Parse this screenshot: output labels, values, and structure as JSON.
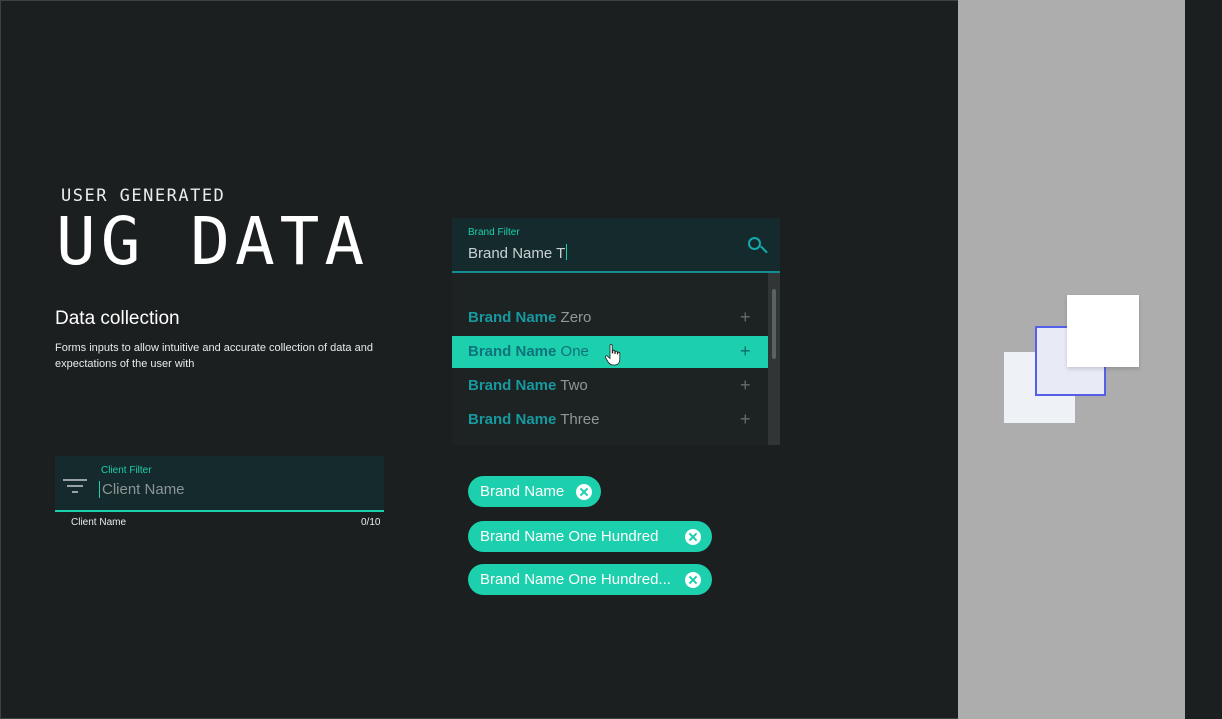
{
  "intro": {
    "eyebrow": "USER GENERATED",
    "title": "UG DATA",
    "section_title": "Data collection",
    "section_desc": "Forms inputs to allow intuitive and accurate collection of data and expectations of the user with"
  },
  "client_filter": {
    "label": "Client Filter",
    "placeholder": "Client Name",
    "helper_text": "Client Name",
    "counter": "0/10",
    "icon": "filter-icon"
  },
  "brand_filter": {
    "label": "Brand Filter",
    "value": "Brand Name T",
    "icon": "search-icon",
    "options": [
      {
        "match": "Brand Name",
        "rest": " Zero",
        "highlighted": false
      },
      {
        "match": "Brand Name",
        "rest": " One",
        "highlighted": true
      },
      {
        "match": "Brand Name",
        "rest": " Two",
        "highlighted": false
      },
      {
        "match": "Brand Name",
        "rest": " Three",
        "highlighted": false
      }
    ],
    "add_symbol": "+"
  },
  "chips": [
    {
      "label": "Brand Name"
    },
    {
      "label": "Brand Name One Hundred"
    },
    {
      "label": "Brand Name One Hundred..."
    }
  ],
  "colors": {
    "background": "#1b1f1f",
    "accent": "#1ccfad",
    "field_bg": "#152a2c",
    "panel_gray": "#adadad",
    "outline_blue": "#5560e8"
  }
}
